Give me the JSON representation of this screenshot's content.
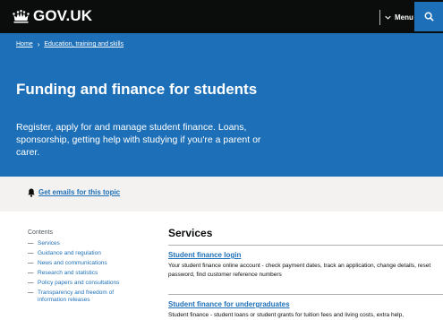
{
  "header": {
    "logo_text": "GOV.UK",
    "menu_label": "Menu",
    "colors": {
      "background": "#0b0c0c",
      "search_bg": "#1d70b8"
    }
  },
  "breadcrumb": [
    {
      "label": "Home"
    },
    {
      "label": "Education, training and skills"
    }
  ],
  "hero": {
    "title": "Funding and finance for students",
    "description": "Register, apply for and manage student finance. Loans, sponsorship, getting help with studying if you're a parent or carer.",
    "color": "#1d70b8"
  },
  "emails": {
    "label": "Get emails for this topic",
    "background": "#f3f2f1"
  },
  "contents": {
    "title": "Contents",
    "items": [
      {
        "label": "Services"
      },
      {
        "label": "Guidance and regulation"
      },
      {
        "label": "News and communications"
      },
      {
        "label": "Research and statistics"
      },
      {
        "label": "Policy papers and consultations"
      },
      {
        "label": "Transparency and freedom of information releases"
      }
    ]
  },
  "services": {
    "title": "Services",
    "items": [
      {
        "link": "Student finance login",
        "description": "Your student finance online account - check payment dates, track an application, change details, reset password, find customer reference numbers"
      },
      {
        "link": "Student finance for undergraduates",
        "description": "Student finance - student loans or student grants for tuition fees and living costs, extra help,"
      }
    ]
  }
}
